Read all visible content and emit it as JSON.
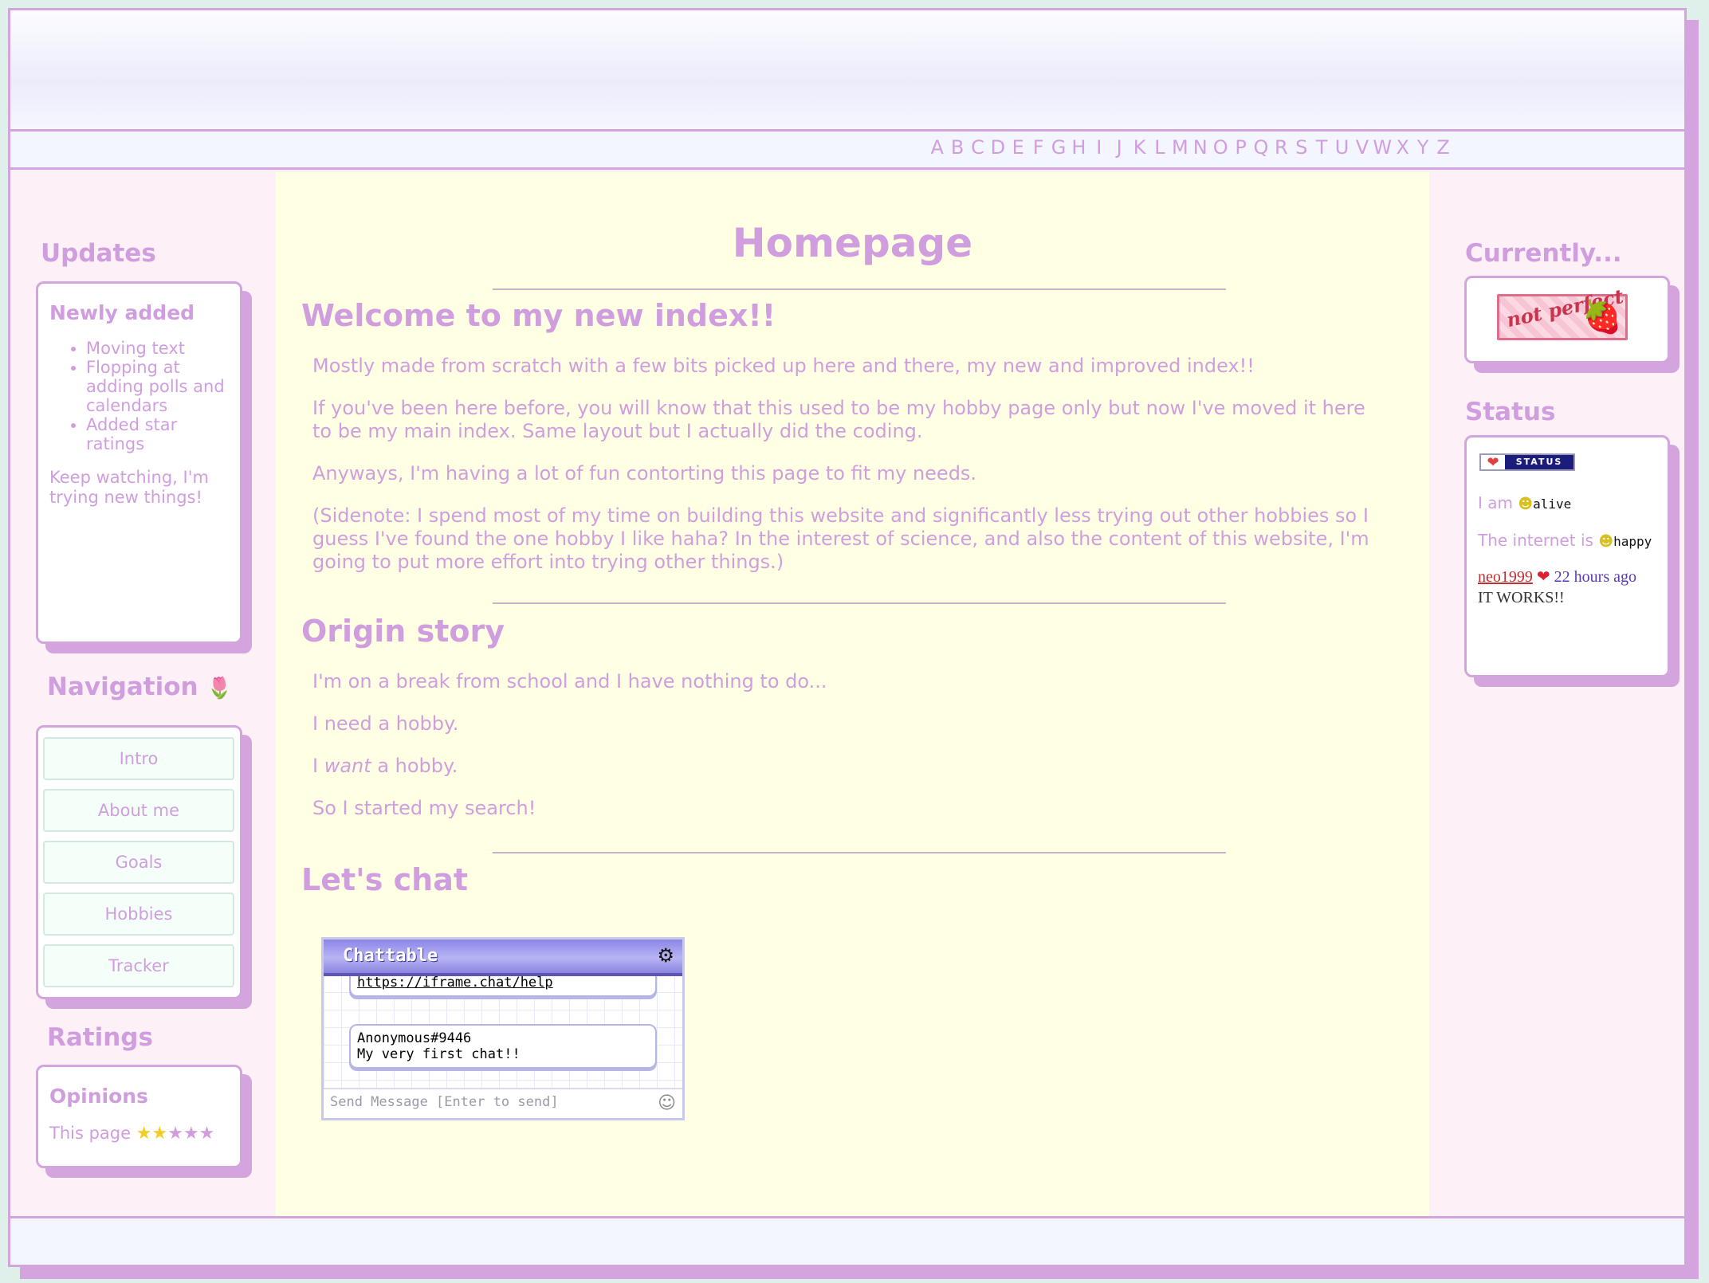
{
  "alphabet": [
    "A",
    "B",
    "C",
    "D",
    "E",
    "F",
    "G",
    "H",
    "I",
    "J",
    "K",
    "L",
    "M",
    "N",
    "O",
    "P",
    "Q",
    "R",
    "S",
    "T",
    "U",
    "V",
    "W",
    "X",
    "Y",
    "Z"
  ],
  "updates": {
    "title": "Updates",
    "subtitle": "Newly added",
    "items": [
      "Moving text",
      "Flopping at adding polls and calendars",
      "Added star ratings"
    ],
    "note": "Keep watching, I'm trying new things!"
  },
  "navigation": {
    "title": "Navigation",
    "links": [
      "Intro",
      "About me",
      "Goals",
      "Hobbies",
      "Tracker"
    ]
  },
  "ratings": {
    "title": "Ratings",
    "subtitle": "Opinions",
    "label": "This page",
    "stars_filled": 2,
    "stars_total": 5,
    "filled_color": "#f5cc20",
    "empty_color": "#d09ede"
  },
  "main": {
    "title": "Homepage",
    "welcome_heading": "Welcome to my new index!!",
    "welcome_paragraphs": [
      "Mostly made from scratch with a few bits picked up here and there, my new and improved index!!",
      "If you've been here before, you will know that this used to be my hobby page only but now I've moved it here to be my main index. Same layout but I actually did the coding.",
      "Anyways, I'm having a lot of fun contorting this page to fit my needs.",
      "(Sidenote: I spend most of my time on building this website and significantly less trying out other hobbies so I guess I've found the one hobby I like haha? In the interest of science, and also the content of this website, I'm going to put more effort into trying other things.)"
    ],
    "origin_heading": "Origin story",
    "origin_paragraphs": [
      "I'm on a break from school and I have nothing to do...",
      "I need a hobby.",
      "I ",
      "want",
      " a hobby.",
      "So I started my search!"
    ],
    "chat_heading": "Let's chat"
  },
  "chat": {
    "title": "Chattable",
    "help_link": "https://iframe.chat/help",
    "message_user": "Anonymous#9446",
    "message_text": "My very first chat!!",
    "input_placeholder": "Send Message [Enter to send]"
  },
  "currently": {
    "title": "Currently...",
    "button_text": "not perfect"
  },
  "status": {
    "title": "Status",
    "badge_label": "STATUS",
    "line1_label": "I am",
    "line1_value": "alive",
    "line2_label": "The internet is",
    "line2_value": "happy",
    "post_user": "neo1999",
    "post_time": "22 hours ago",
    "post_text": "IT WORKS!!"
  },
  "colors": {
    "accent": "#d09ede",
    "border": "#d3a4dd",
    "main_bg": "#ffffe4",
    "side_bg": "#fdf0f6"
  }
}
